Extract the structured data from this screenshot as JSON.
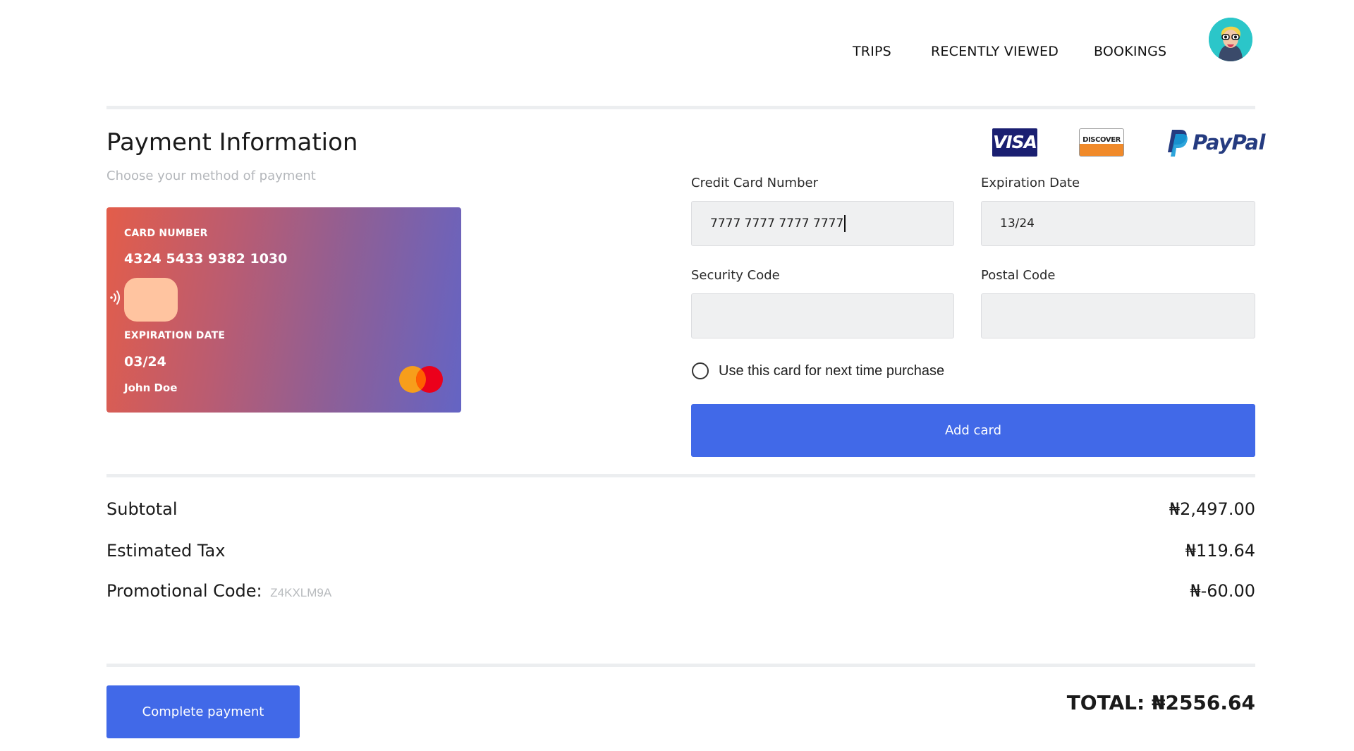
{
  "nav": {
    "items": [
      {
        "label": "TRIPS"
      },
      {
        "label": "RECENTLY VIEWED"
      },
      {
        "label": "BOOKINGS"
      }
    ]
  },
  "page": {
    "title": "Payment Information",
    "subtitle": "Choose your method of payment"
  },
  "card": {
    "number_label": "CARD NUMBER",
    "number": "4324 5433 9382 1030",
    "expiration_label": "EXPIRATION DATE",
    "expiration": "03/24",
    "holder": "John Doe"
  },
  "payment_methods": {
    "visa_text": "VISA",
    "discover_text": "DISCOVER",
    "paypal_text": "PayPal"
  },
  "form": {
    "credit_card_label": "Credit Card Number",
    "credit_card_value": "7777 7777 7777 7777",
    "expiration_label": "Expiration Date",
    "expiration_value": "13/24",
    "security_label": "Security Code",
    "security_value": "",
    "postal_label": "Postal Code",
    "postal_value": "",
    "save_card_label": "Use this card for next time purchase",
    "add_card_label": "Add card"
  },
  "summary": {
    "subtotal_label": "Subtotal",
    "subtotal_value": "₦2,497.00",
    "tax_label": "Estimated Tax",
    "tax_value": "₦119.64",
    "promo_label": "Promotional Code:",
    "promo_code": "Z4KXLM9A",
    "promo_value": "₦-60.00"
  },
  "footer": {
    "complete_label": "Complete payment",
    "total": "TOTAL: ₦2556.64"
  },
  "colors": {
    "accent": "#4169e8",
    "field_bg": "#eff0f1",
    "card_gradient_start": "#e35d4a",
    "card_gradient_end": "#6464c4"
  }
}
